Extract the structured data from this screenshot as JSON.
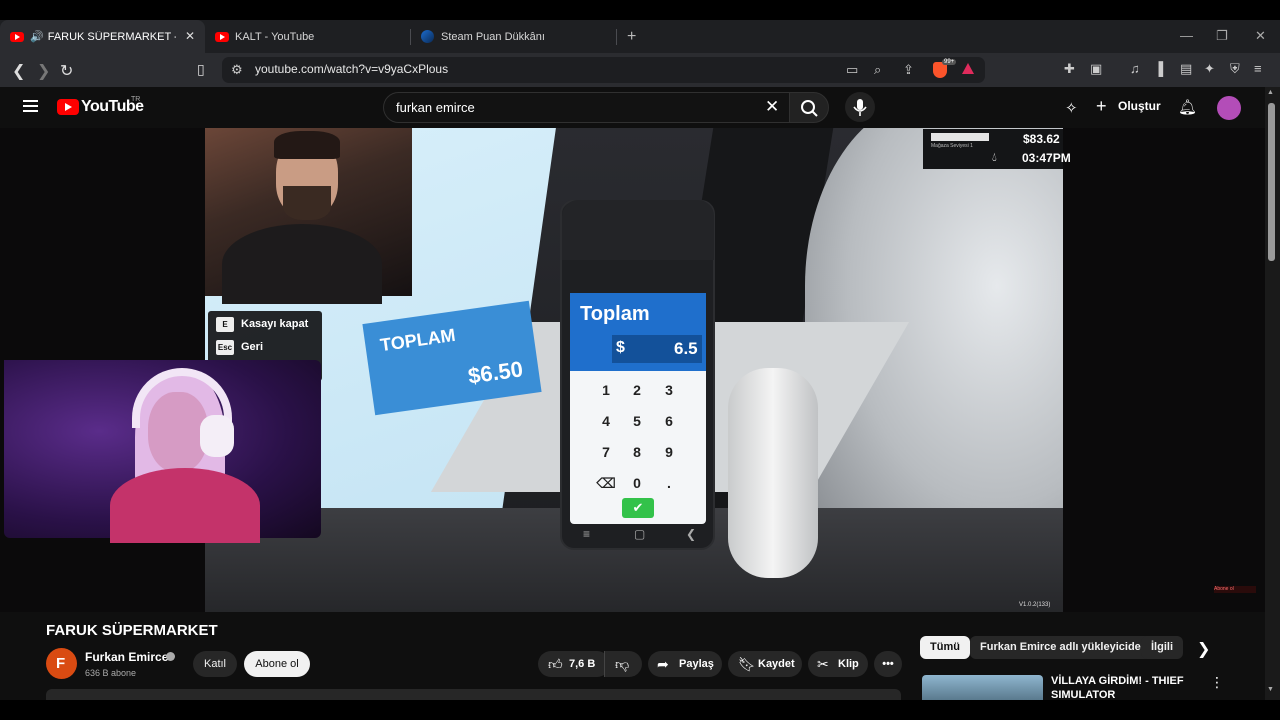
{
  "browser": {
    "tabs": [
      {
        "label": "FARUK SÜPERMARKET - YouTube",
        "active": true
      },
      {
        "label": "KALT - YouTube",
        "active": false
      },
      {
        "label": "Steam Puan Dükkânı",
        "active": false
      }
    ],
    "new_tab": "+",
    "url": "youtube.com/watch?v=v9yaCxPlous",
    "brave_badge": "99+"
  },
  "youtube": {
    "wordmark": "YouTube",
    "region": "TR",
    "search_value": "furkan emirce",
    "create_label": "Oluştur"
  },
  "video": {
    "game": {
      "hint_close_key": "E",
      "hint_close_label": "Kasayı kapat",
      "hint_back_key": "Esc",
      "hint_back_label": "Geri",
      "screen_label": "TOPLAM",
      "screen_price": "$6.50",
      "terminal_title": "Toplam",
      "terminal_currency": "$",
      "terminal_amount": "6.5",
      "keypad": [
        "1",
        "2",
        "3",
        "4",
        "5",
        "6",
        "7",
        "8",
        "9",
        "⌫",
        "0",
        "."
      ],
      "hud_money": "$83.62",
      "hud_time": "03:47PM",
      "hud_store": "Mağaza Seviyesi 1",
      "version": "V1.0.2(133)",
      "mini_subscribe": "Abone ol"
    }
  },
  "below": {
    "title": "FARUK SÜPERMARKET",
    "channel_name": "Furkan Emirce",
    "subscribers": "636 B abone",
    "join_label": "Katıl",
    "subscribe_label": "Abone ol",
    "likes": "7,6 B",
    "share_label": "Paylaş",
    "save_label": "Kaydet",
    "clip_label": "Klip"
  },
  "sidebar": {
    "chips": [
      "Tümü",
      "Furkan Emirce adlı yükleyiciden",
      "İlgili"
    ],
    "rec_title": "VİLLAYA GİRDİM! - THIEF SIMULATOR"
  }
}
